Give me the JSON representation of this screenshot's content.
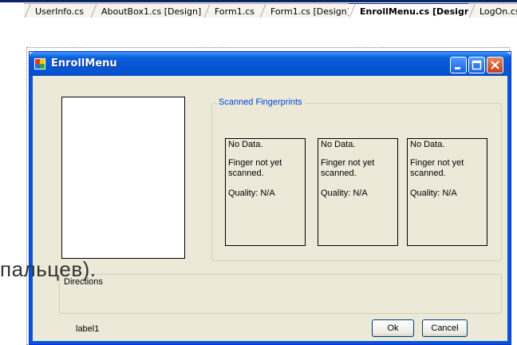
{
  "tabs": [
    {
      "label": "UserInfo.cs",
      "active": false
    },
    {
      "label": "AboutBox1.cs [Design]",
      "active": false
    },
    {
      "label": "Form1.cs",
      "active": false
    },
    {
      "label": "Form1.cs [Design]",
      "active": false
    },
    {
      "label": "EnrollMenu.cs [Design]",
      "active": true
    },
    {
      "label": "LogOn.cs",
      "active": false
    }
  ],
  "form": {
    "title": "EnrollMenu",
    "group_title": "Scanned Fingerprints",
    "fingerprints": [
      {
        "status": "No Data.",
        "message": "Finger not yet scanned.",
        "quality": "Quality: N/A"
      },
      {
        "status": "No Data.",
        "message": "Finger not yet scanned.",
        "quality": "Quality: N/A"
      },
      {
        "status": "No Data.",
        "message": "Finger not yet scanned.",
        "quality": "Quality: N/A"
      }
    ],
    "directions_label": "Directions",
    "label1": "label1",
    "ok_label": "Ok",
    "cancel_label": "Cancel"
  },
  "overlay_text": "пальцев).",
  "colors": {
    "titlebar": "#0a5fd8",
    "form_bg": "#ece9d8",
    "group_title": "#0046d5",
    "close_button": "#c4401d"
  }
}
